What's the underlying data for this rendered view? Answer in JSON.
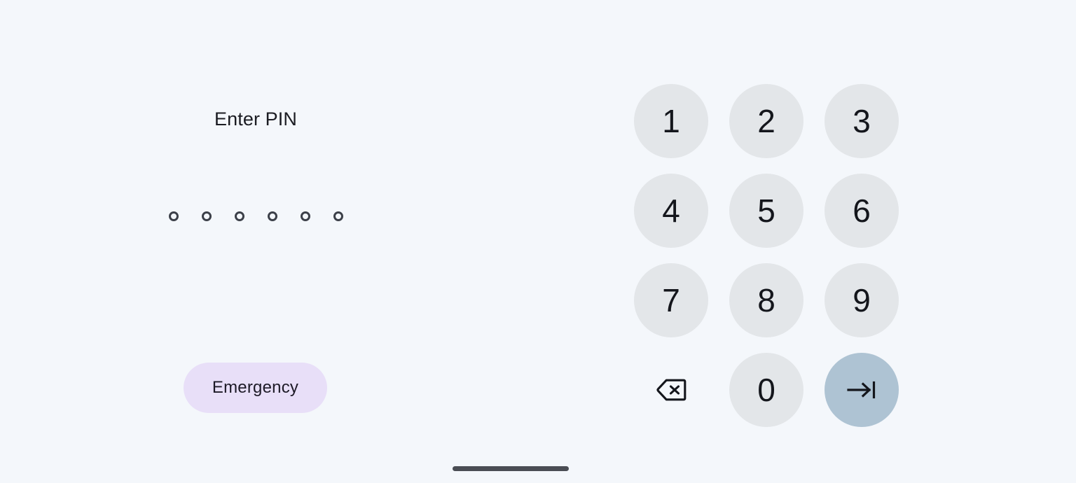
{
  "screen": {
    "name": "lock-screen-pin-entry",
    "background_color": "#f4f7fb"
  },
  "prompt": {
    "title": "Enter PIN"
  },
  "pin_field": {
    "slots": 6,
    "filled_count": 0,
    "dot_color": "#3c4049",
    "dots": [
      {
        "state": "empty"
      },
      {
        "state": "empty"
      },
      {
        "state": "empty"
      },
      {
        "state": "empty"
      },
      {
        "state": "empty"
      },
      {
        "state": "empty"
      }
    ]
  },
  "emergency": {
    "label": "Emergency",
    "background_color": "#e8dff8",
    "text_color": "#1d1a27"
  },
  "keypad": {
    "key_color": "#e3e6e9",
    "key_text_color": "#14161c",
    "submit_color": "#aec3d3",
    "keys": [
      {
        "label": "1",
        "name": "key-1",
        "type": "digit"
      },
      {
        "label": "2",
        "name": "key-2",
        "type": "digit"
      },
      {
        "label": "3",
        "name": "key-3",
        "type": "digit"
      },
      {
        "label": "4",
        "name": "key-4",
        "type": "digit"
      },
      {
        "label": "5",
        "name": "key-5",
        "type": "digit"
      },
      {
        "label": "6",
        "name": "key-6",
        "type": "digit"
      },
      {
        "label": "7",
        "name": "key-7",
        "type": "digit"
      },
      {
        "label": "8",
        "name": "key-8",
        "type": "digit"
      },
      {
        "label": "9",
        "name": "key-9",
        "type": "digit"
      },
      {
        "label": "",
        "name": "backspace-key",
        "type": "backspace",
        "icon": "backspace-icon"
      },
      {
        "label": "0",
        "name": "key-0",
        "type": "digit"
      },
      {
        "label": "",
        "name": "submit-key",
        "type": "submit",
        "icon": "arrow-to-bar-icon"
      }
    ]
  },
  "navigation": {
    "home_indicator_color": "#4a4d54"
  }
}
